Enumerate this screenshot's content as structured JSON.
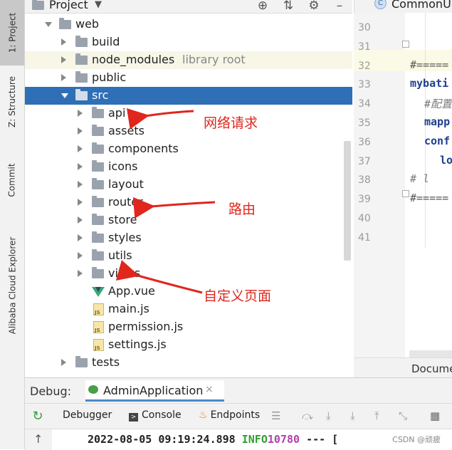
{
  "window": {
    "project_title": "Project"
  },
  "side_tabs": [
    {
      "label": "1: Project"
    },
    {
      "label": "Z: Structure"
    },
    {
      "label": "Commit"
    },
    {
      "label": "Alibaba Cloud Explorer"
    }
  ],
  "tree": [
    {
      "label": "web",
      "type": "folder",
      "depth": 0,
      "expanded": true
    },
    {
      "label": "build",
      "type": "folder",
      "depth": 1,
      "expanded": false
    },
    {
      "label": "node_modules",
      "tag": "library root",
      "type": "folder",
      "depth": 1,
      "expanded": false,
      "library": true
    },
    {
      "label": "public",
      "type": "folder",
      "depth": 1,
      "expanded": false
    },
    {
      "label": "src",
      "type": "folder",
      "depth": 1,
      "expanded": true,
      "selected": true
    },
    {
      "label": "api",
      "type": "folder",
      "depth": 2,
      "expanded": false
    },
    {
      "label": "assets",
      "type": "folder",
      "depth": 2,
      "expanded": false
    },
    {
      "label": "components",
      "type": "folder",
      "depth": 2,
      "expanded": false
    },
    {
      "label": "icons",
      "type": "folder",
      "depth": 2,
      "expanded": false
    },
    {
      "label": "layout",
      "type": "folder",
      "depth": 2,
      "expanded": false
    },
    {
      "label": "router",
      "type": "folder",
      "depth": 2,
      "expanded": false
    },
    {
      "label": "store",
      "type": "folder",
      "depth": 2,
      "expanded": false
    },
    {
      "label": "styles",
      "type": "folder",
      "depth": 2,
      "expanded": false
    },
    {
      "label": "utils",
      "type": "folder",
      "depth": 2,
      "expanded": false
    },
    {
      "label": "views",
      "type": "folder",
      "depth": 2,
      "expanded": false
    },
    {
      "label": "App.vue",
      "type": "vue",
      "depth": 2
    },
    {
      "label": "main.js",
      "type": "js",
      "depth": 2
    },
    {
      "label": "permission.js",
      "type": "js",
      "depth": 2
    },
    {
      "label": "settings.js",
      "type": "js",
      "depth": 2
    },
    {
      "label": "tests",
      "type": "folder",
      "depth": 1,
      "expanded": false
    }
  ],
  "annotations": {
    "api": "网络请求",
    "router": "路由",
    "views": "自定义页面",
    "color": "#e0261d"
  },
  "editor": {
    "tab_label": "CommonU",
    "tab_icon": "C",
    "line_numbers": [
      "30",
      "31",
      "32",
      "33",
      "34",
      "35",
      "36",
      "37",
      "38",
      "39",
      "40",
      "41"
    ],
    "code_lines": [
      {
        "text": "",
        "style": ""
      },
      {
        "text": "",
        "style": ""
      },
      {
        "text": "#=====",
        "style": "gray"
      },
      {
        "text": "mybati",
        "style": "bold"
      },
      {
        "text": "#配置",
        "style": "comment"
      },
      {
        "text": "mapp",
        "style": "bold"
      },
      {
        "text": "conf",
        "style": "bold"
      },
      {
        "text": "lo",
        "style": "bold"
      },
      {
        "text": "#   l",
        "style": "comment"
      },
      {
        "text": "#=====",
        "style": "gray"
      },
      {
        "text": "",
        "style": ""
      },
      {
        "text": "",
        "style": ""
      }
    ],
    "bottom_label": "Docume"
  },
  "debug": {
    "label": "Debug:",
    "session_tab": "AdminApplication",
    "close_glyph": "×",
    "toolbar": {
      "debugger": "Debugger",
      "console": "Console",
      "endpoints": "Endpoints"
    },
    "log": {
      "timestamp": "2022-08-05 09:19:24.898",
      "level": "INFO",
      "pid": "10780",
      "separator": "--- ["
    }
  },
  "watermark": "CSDN @顽疲"
}
